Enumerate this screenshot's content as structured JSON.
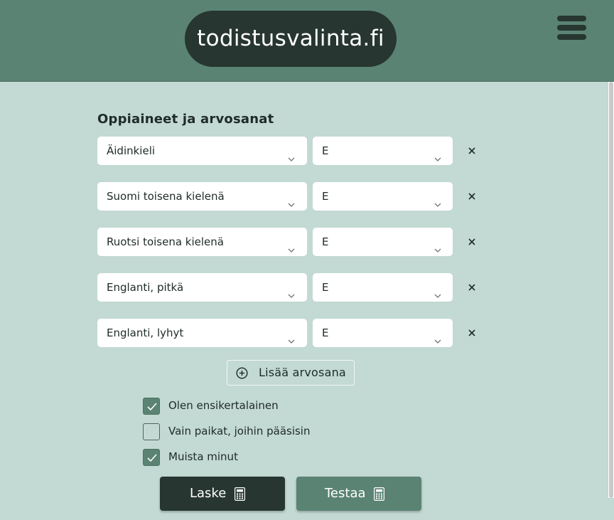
{
  "header": {
    "logo_text": "todistusvalinta.fi",
    "menu_icon": "hamburger-menu-icon",
    "colors": {
      "bar": "#5a8374",
      "logo_bg": "#273631"
    }
  },
  "form": {
    "title": "Oppiaineet ja arvosanat",
    "rows": [
      {
        "subject": "Äidinkieli",
        "grade": "E"
      },
      {
        "subject": "Suomi toisena kielenä",
        "grade": "E"
      },
      {
        "subject": "Ruotsi toisena kielenä",
        "grade": "E"
      },
      {
        "subject": "Englanti, pitkä",
        "grade": "E"
      },
      {
        "subject": "Englanti, lyhyt",
        "grade": "E"
      }
    ],
    "add_label": "Lisää arvosana"
  },
  "options": [
    {
      "label": "Olen ensikertalainen",
      "checked": true
    },
    {
      "label": "Vain paikat, joihin pääsisin",
      "checked": false
    },
    {
      "label": "Muista minut",
      "checked": true
    }
  ],
  "actions": {
    "calculate_label": "Laske",
    "test_label": "Testaa",
    "icon": "calculator-icon"
  },
  "colors": {
    "page_bg": "#c3d9d3",
    "accent": "#5a8374",
    "dark": "#273631"
  }
}
